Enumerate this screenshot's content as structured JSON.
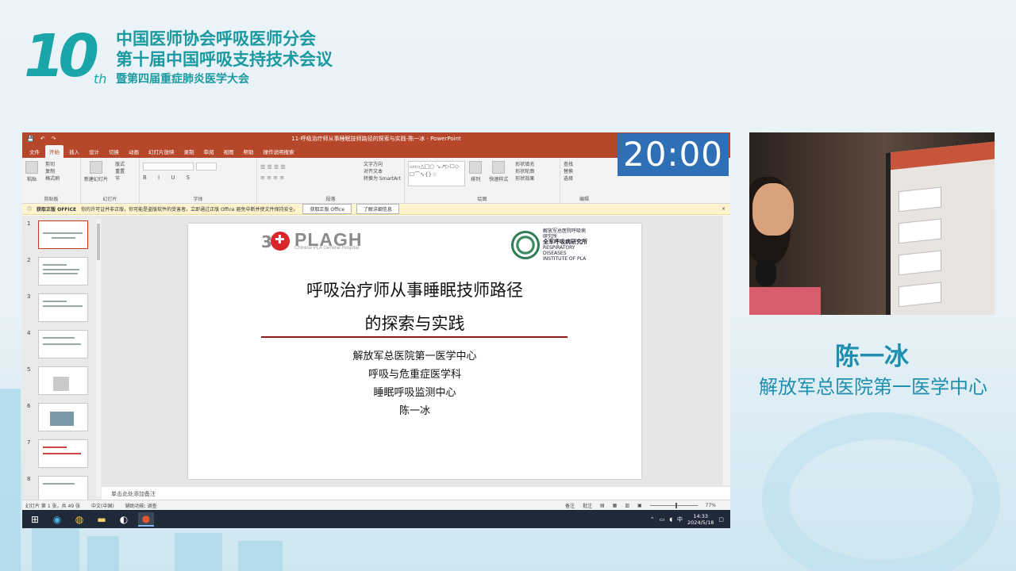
{
  "banner": {
    "logo_number": "10",
    "logo_suffix": "th",
    "line1": "中国医师协会呼吸医师分会",
    "line2": "第十届中国呼吸支持技术会议",
    "line3": "暨第四届重症肺炎医学大会"
  },
  "window": {
    "title": "11-呼吸治疗师从事睡眠技师路径的探索与实践-陈一冰 - PowerPoint",
    "tabs": [
      "文件",
      "开始",
      "插入",
      "设计",
      "切换",
      "动画",
      "幻灯片放映",
      "录制",
      "审阅",
      "视图",
      "帮助",
      "操作说明搜索"
    ],
    "active_tab": "开始"
  },
  "ribbon": {
    "groups": [
      {
        "label": "剪贴板",
        "big": "粘贴",
        "items": [
          "剪切",
          "复制",
          "格式刷"
        ]
      },
      {
        "label": "幻灯片",
        "big": "新建幻灯片",
        "items": [
          "版式",
          "重置",
          "节"
        ]
      },
      {
        "label": "字体",
        "items": []
      },
      {
        "label": "段落",
        "items": [
          "文字方向",
          "对齐文本",
          "转换为 SmartArt"
        ]
      },
      {
        "label": "绘图",
        "big": "排列",
        "items": [
          "快速样式",
          "形状填充",
          "形状轮廓",
          "形状效果"
        ]
      },
      {
        "label": "编辑",
        "items": [
          "查找",
          "替换",
          "选择"
        ]
      }
    ]
  },
  "notification": {
    "title": "获取正版 OFFICE",
    "message": "你的许可证并非正版，你可能是盗版软件的受害者。立即通过正版 Office 避免中断并使文件保持安全。",
    "button1": "获取正版 Office",
    "button2": "了解详细信息"
  },
  "thumbnails": [
    "1",
    "2",
    "3",
    "4",
    "5",
    "6",
    "7",
    "8"
  ],
  "slide": {
    "logo_text": "PLAGH",
    "logo_sub": "Chinese PLA General Hospital",
    "seal_lines": [
      "解放军总医院呼吸病研究所",
      "全军呼吸病研究所",
      "RESPIRATORY DISEASES INSTITUTE OF PLA"
    ],
    "title_line1": "呼吸治疗师从事睡眠技师路径",
    "title_line2": "的探索与实践",
    "body": [
      "解放军总医院第一医学中心",
      "呼吸与危重症医学科",
      "睡眠呼吸监测中心",
      "陈一冰"
    ]
  },
  "notes_placeholder": "单击此处添加备注",
  "status": {
    "slide_info": "幻灯片 第 1 张，共 49 张",
    "language": "中文(中国)",
    "accessibility": "辅助功能: 调查",
    "notes_btn": "备注",
    "comments_btn": "批注",
    "zoom": "77%"
  },
  "taskbar": {
    "time": "14:33",
    "date": "2024/5/18",
    "ime": "中"
  },
  "timer": "20:00",
  "speaker": {
    "name": "陈一冰",
    "org": "解放军总医院第一医学中心"
  },
  "colors": {
    "ppt_accent": "#b7472a",
    "brand_teal": "#1a9aa0",
    "timer_bg": "#2f6fb5"
  }
}
